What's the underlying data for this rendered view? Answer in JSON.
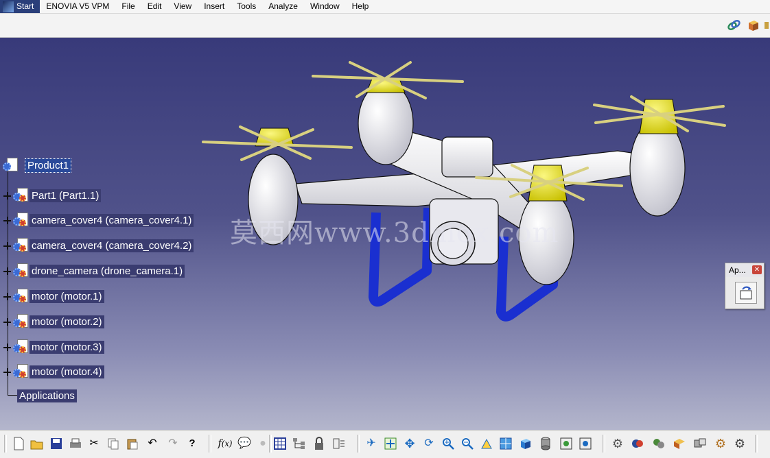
{
  "menu": {
    "start": "Start",
    "enovia": "ENOVIA V5 VPM",
    "items": [
      "File",
      "Edit",
      "View",
      "Insert",
      "Tools",
      "Analyze",
      "Window",
      "Help"
    ]
  },
  "tree": {
    "root": "Product1",
    "children": [
      "Part1 (Part1.1)",
      "camera_cover4 (camera_cover4.1)",
      "camera_cover4 (camera_cover4.2)",
      "drone_camera (drone_camera.1)",
      "motor (motor.1)",
      "motor (motor.2)",
      "motor (motor.3)",
      "motor (motor.4)"
    ],
    "applications": "Applications"
  },
  "watermark": "莫西网www.3dmox.com",
  "palette": {
    "title": "Ap...",
    "close": "✕"
  },
  "colors": {
    "viewport_top": "#383a7a",
    "viewport_bottom": "#b4b6cc",
    "drone_body": "#eeeeee",
    "propeller_hub": "#e8e020",
    "landing_gear": "#1a2fd0"
  },
  "toolbar_icons": [
    "new-icon",
    "open-icon",
    "save-icon",
    "print-icon",
    "cut-icon",
    "copy-icon",
    "paste-icon",
    "undo-icon",
    "redo-icon",
    "whats-this-icon",
    "formula-icon",
    "comment-icon",
    "light-icon",
    "table-icon",
    "tree-icon",
    "lock-icon",
    "catalog-icon",
    "fly-icon",
    "fit-all-icon",
    "pan-icon",
    "rotate-icon",
    "zoom-in-icon",
    "zoom-out-icon",
    "normal-view-icon",
    "multi-view-icon",
    "iso-view-icon",
    "shading-icon",
    "hide-show-icon",
    "swap-icon",
    "gear-icon",
    "product-icon",
    "assembly-icon",
    "constraint-icon",
    "explode-icon",
    "settings-icon",
    "mechanism-icon"
  ]
}
